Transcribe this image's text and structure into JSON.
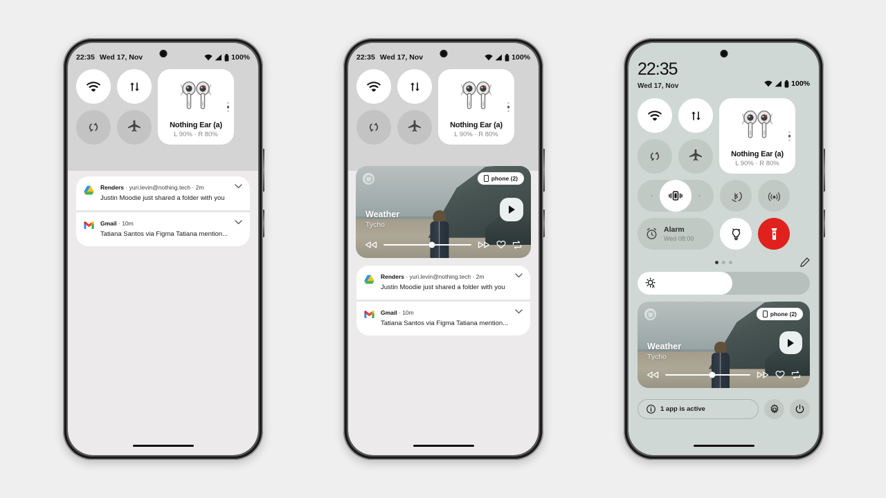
{
  "background_color": "#efefef",
  "phones": [
    {
      "id": "phone-1",
      "status": {
        "time": "22:35",
        "date": "Wed 17, Nov",
        "battery": "100%"
      },
      "quick_settings": {
        "tiles": [
          {
            "name": "wifi",
            "icon": "wifi-icon",
            "state": "on"
          },
          {
            "name": "data",
            "icon": "data-arrows-icon",
            "state": "on"
          },
          {
            "name": "auto-rotate",
            "icon": "rotate-icon",
            "state": "off"
          },
          {
            "name": "airplane",
            "icon": "airplane-icon",
            "state": "off"
          }
        ],
        "device": {
          "title": "Nothing Ear (a)",
          "battery": "L 90% · R 80%",
          "icon": "earbuds-icon"
        }
      },
      "notifications": [
        {
          "app": "Renders",
          "meta": "· yuri.levin@nothing.tech · 2m",
          "text": "Justin Moodie just shared a folder with you",
          "icon": "google-drive-icon"
        },
        {
          "app": "Gmail",
          "meta": "· 10m",
          "text": "Tatiana Santos via Figma Tatiana mention...",
          "icon": "gmail-icon"
        }
      ],
      "media": null
    },
    {
      "id": "phone-2",
      "status": {
        "time": "22:35",
        "date": "Wed 17, Nov",
        "battery": "100%"
      },
      "quick_settings": {
        "tiles": [
          {
            "name": "wifi",
            "icon": "wifi-icon",
            "state": "on"
          },
          {
            "name": "data",
            "icon": "data-arrows-icon",
            "state": "on"
          },
          {
            "name": "auto-rotate",
            "icon": "rotate-icon",
            "state": "off"
          },
          {
            "name": "airplane",
            "icon": "airplane-icon",
            "state": "off"
          }
        ],
        "device": {
          "title": "Nothing Ear (a)",
          "battery": "L 90% · R 80%",
          "icon": "earbuds-icon"
        }
      },
      "notifications": [
        {
          "app": "Renders",
          "meta": "· yuri.levin@nothing.tech · 2m",
          "text": "Justin Moodie just shared a folder with you",
          "icon": "google-drive-icon"
        },
        {
          "app": "Gmail",
          "meta": "· 10m",
          "text": "Tatiana Santos via Figma Tatiana mention...",
          "icon": "gmail-icon"
        }
      ],
      "media": {
        "app_icon": "spotify-icon",
        "output_chip": {
          "label": "phone (2)",
          "icon": "phone-icon"
        },
        "title": "Weather",
        "artist": "Tycho",
        "progress_percent": 55,
        "controls": [
          "rewind-icon",
          "forward-icon",
          "heart-icon",
          "repeat-icon"
        ],
        "play_state": "play-icon"
      }
    },
    {
      "id": "phone-3",
      "status": {
        "time": "22:35",
        "date": "Wed 17, Nov",
        "battery": "100%"
      },
      "quick_settings": {
        "tiles": [
          {
            "name": "wifi",
            "icon": "wifi-icon",
            "state": "on"
          },
          {
            "name": "data",
            "icon": "data-arrows-icon",
            "state": "on"
          },
          {
            "name": "auto-rotate",
            "icon": "rotate-icon",
            "state": "off"
          },
          {
            "name": "airplane",
            "icon": "airplane-icon",
            "state": "off"
          }
        ],
        "device": {
          "title": "Nothing Ear (a)",
          "battery": "L 90% · R 80%",
          "icon": "earbuds-icon"
        },
        "row2": [
          {
            "name": "ringer-vibrate",
            "icon": "vibrate-icon",
            "state": "on",
            "shape": "pill"
          },
          {
            "name": "bluetooth-scan",
            "icon": "scan-icon",
            "state": "off",
            "shape": "circle"
          },
          {
            "name": "hotspot",
            "icon": "hotspot-icon",
            "state": "off",
            "shape": "circle"
          }
        ],
        "row3": {
          "alarm": {
            "label": "Alarm",
            "value": "Wed 08:00",
            "icon": "alarm-icon",
            "state": "off"
          },
          "nightlight": {
            "name": "night-light",
            "icon": "nightlight-icon",
            "state": "on"
          },
          "flashlight": {
            "name": "flashlight",
            "icon": "flashlight-icon",
            "state": "on",
            "color": "#e0211d"
          }
        },
        "pager": {
          "pages": 3,
          "active": 0
        },
        "edit_icon": "pencil-icon",
        "brightness": {
          "icon": "brightness-auto-icon",
          "value_percent": 55
        }
      },
      "media": {
        "app_icon": "spotify-icon",
        "output_chip": {
          "label": "phone (2)",
          "icon": "phone-icon"
        },
        "title": "Weather",
        "artist": "Tycho",
        "progress_percent": 55,
        "controls": [
          "rewind-icon",
          "forward-icon",
          "heart-icon",
          "repeat-icon"
        ],
        "play_state": "play-icon"
      },
      "footer": {
        "active_apps": {
          "label": "1 app is active",
          "icon": "info-icon"
        },
        "settings_icon": "gear-icon",
        "power_icon": "power-icon"
      }
    }
  ]
}
